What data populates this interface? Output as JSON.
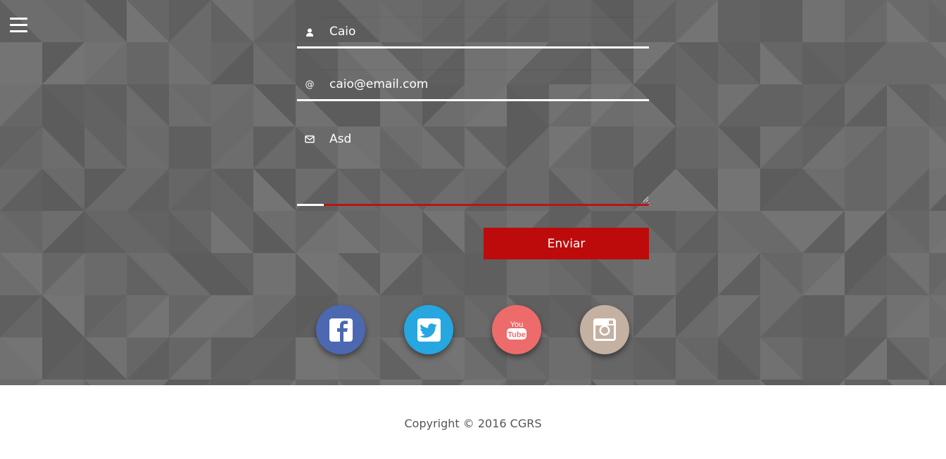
{
  "nav": {
    "menu_icon": "hamburger-menu-icon"
  },
  "form": {
    "name": {
      "icon": "user-icon",
      "value": "Caio"
    },
    "email": {
      "icon": "at-icon",
      "icon_glyph": "@",
      "value": "caio@email.com"
    },
    "message": {
      "icon": "envelope-icon",
      "value": "Asd"
    },
    "submit_label": "Enviar"
  },
  "social": [
    {
      "name": "facebook",
      "icon": "facebook-icon",
      "color": "#4c68b0"
    },
    {
      "name": "twitter",
      "icon": "twitter-icon",
      "color": "#26a7e0"
    },
    {
      "name": "youtube",
      "icon": "youtube-icon",
      "color": "#ee6b6b"
    },
    {
      "name": "instagram",
      "icon": "instagram-icon",
      "color": "#c4b1a2"
    }
  ],
  "footer": {
    "copyright": "Copyright © 2016 CGRS"
  },
  "colors": {
    "accent": "#bd0b0b",
    "background": "#676767",
    "footer_bg": "#ffffff"
  }
}
